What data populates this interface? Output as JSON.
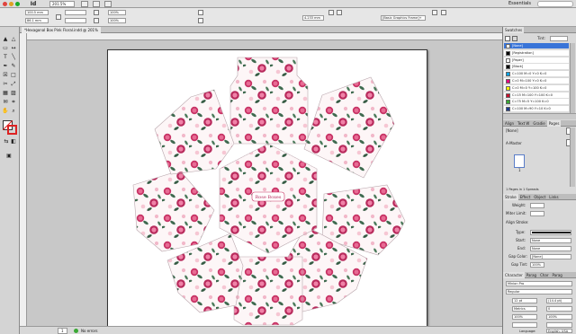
{
  "app": {
    "logo": "Id",
    "zoom": "201.5%",
    "workspace": "Essentials"
  },
  "control": {
    "x": "100.5 mm",
    "y": "86.1 mm",
    "w": "4.233 mm",
    "scale": "100%",
    "frame_style": "[Basic Graphics Frame]+"
  },
  "document": {
    "tab_title": "*Hexagonal Box Pink Floral.indd @ 201%"
  },
  "page_art": {
    "center_label": "Rose Boxes"
  },
  "status": {
    "page": "1",
    "errors": "No errors"
  },
  "swatches": {
    "title": "Swatches",
    "tint_label": "Tint:",
    "items": [
      {
        "name": "[None]",
        "color": "#ffffff"
      },
      {
        "name": "[Registration]",
        "color": "#000000"
      },
      {
        "name": "[Paper]",
        "color": "#ffffff"
      },
      {
        "name": "[Black]",
        "color": "#000000"
      },
      {
        "name": "C=100 M=0 Y=0 K=0",
        "color": "#00a0e3"
      },
      {
        "name": "C=0 M=100 Y=0 K=0",
        "color": "#e4007f"
      },
      {
        "name": "C=0 M=0 Y=100 K=0",
        "color": "#fff200"
      },
      {
        "name": "C=15 M=100 Y=100 K=0",
        "color": "#c8102e"
      },
      {
        "name": "C=75 M=5 Y=100 K=0",
        "color": "#3aa935"
      },
      {
        "name": "C=100 M=90 Y=10 K=0",
        "color": "#1d3a8f"
      }
    ]
  },
  "pages_panel": {
    "tabs": [
      "Align",
      "Text W",
      "Gradie",
      "Pages"
    ],
    "none_label": "[None]",
    "master_label": "A-Master",
    "page_num": "1",
    "summary": "1 Pages in 1 Spreads"
  },
  "stroke": {
    "tabs": [
      "Stroke",
      "Effect",
      "Object",
      "Links"
    ],
    "weight_label": "Weight:",
    "miter_label": "Miter Limit:",
    "align_label": "Align Stroke:",
    "type_label": "Type:",
    "start_label": "Start:",
    "start_value": "None",
    "end_label": "End:",
    "end_value": "None",
    "gap_color_label": "Gap Color:",
    "gap_color_value": "[None]",
    "gap_tint_label": "Gap Tint:",
    "gap_tint_value": "100%"
  },
  "character": {
    "tabs": [
      "Character",
      "Parag",
      "Char",
      "Parag"
    ],
    "font": "Minion Pro",
    "style": "Regular",
    "size": "12 pt",
    "leading": "(14.4 pt)",
    "kerning": "Metrics",
    "tracking": "0",
    "vscale": "100%",
    "hscale": "100%",
    "language_label": "Language:",
    "language": "English: USA"
  }
}
